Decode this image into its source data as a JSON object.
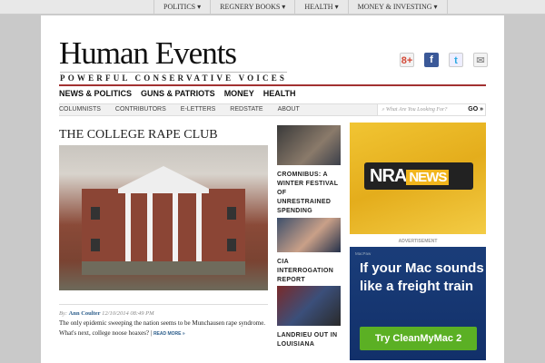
{
  "topnav": [
    "POLITICS ▾",
    "REGNERY BOOKS ▾",
    "HEALTH ▾",
    "MONEY & INVESTING ▾"
  ],
  "logo": "Human Events",
  "tagline": "POWERFUL CONSERVATIVE VOICES",
  "social": {
    "gplus": "8+",
    "facebook": "f",
    "twitter": "t",
    "email": "✉"
  },
  "mainnav": [
    "NEWS & POLITICS",
    "GUNS & PATRIOTS",
    "MONEY",
    "HEALTH"
  ],
  "subnav": [
    "COLUMNISTS",
    "CONTRIBUTORS",
    "E-LETTERS",
    "REDSTATE",
    "ABOUT"
  ],
  "search": {
    "placeholder": "What Are You Looking For?",
    "go": "GO »"
  },
  "article": {
    "title": "THE COLLEGE RAPE CLUB",
    "by": "By:",
    "author": "Ann Coulter",
    "date": "12/10/2014 08:49 PM",
    "excerpt": "The only epidemic sweeping the nation seems to be Munchausen rape syndrome. What's next, college noose hoaxes? |",
    "read_more": "READ MORE »"
  },
  "side_stories": [
    "CROMNIBUS: A WINTER FESTIVAL OF UNRESTRAINED SPENDING",
    "CIA INTERROGATION REPORT PUBLISHED",
    "LANDRIEU OUT IN LOUISIANA"
  ],
  "ads": {
    "nra_a": "NRA",
    "nra_b": "NEWS",
    "label": "ADVERTISEMENT",
    "brand": "MacPaw",
    "headline": "If your Mac sounds like a freight train",
    "cta": "Try CleanMyMac 2"
  }
}
